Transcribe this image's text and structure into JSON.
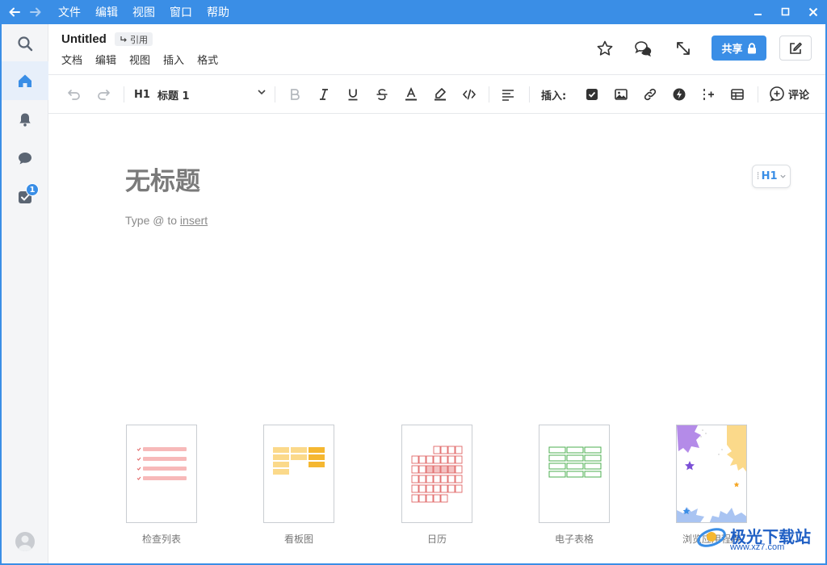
{
  "titlebar": {
    "menu": [
      "文件",
      "编辑",
      "视图",
      "窗口",
      "帮助"
    ]
  },
  "doc": {
    "title": "Untitled",
    "ref_label": "引用",
    "menu": [
      "文档",
      "编辑",
      "视图",
      "插入",
      "格式"
    ],
    "share_label": "共享"
  },
  "toolbar": {
    "heading_icon": "H1",
    "heading_label": "标题 1",
    "insert_label": "插入:",
    "comment_label": "评论"
  },
  "editor": {
    "page_title": "无标题",
    "placeholder_prefix": "Type @ to ",
    "placeholder_link": "insert",
    "heading_badge": "H1"
  },
  "sidebar": {
    "tasks_badge": "1"
  },
  "templates": [
    {
      "label": "检查列表"
    },
    {
      "label": "看板图"
    },
    {
      "label": "日历"
    },
    {
      "label": "电子表格"
    },
    {
      "label": "浏览应用程序"
    }
  ],
  "watermark": {
    "text": "极光下载站",
    "url": "www.xz7.com"
  },
  "colors": {
    "accent": "#3a8ee6",
    "checklist": "#f4a3a3",
    "kanban": "#f5b731",
    "calendar": "#e06666",
    "spreadsheet": "#4caf50"
  }
}
